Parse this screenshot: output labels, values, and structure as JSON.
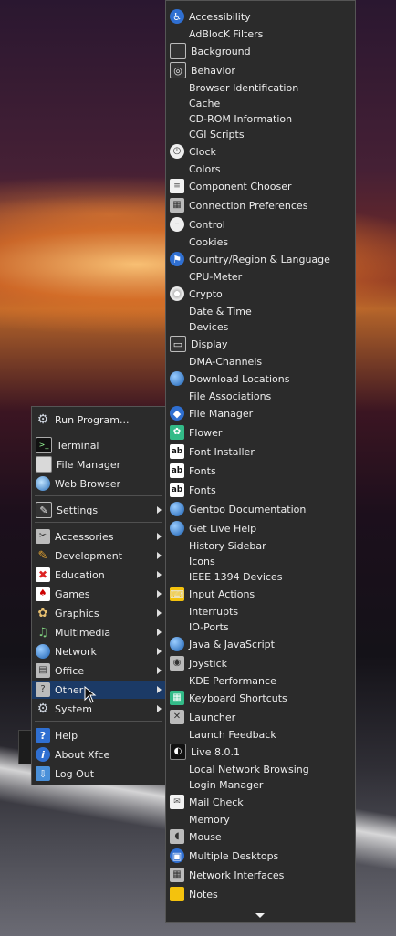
{
  "main_menu": {
    "items": [
      {
        "label": "Run Program...",
        "icon": "gear-icon",
        "submenu": false
      },
      {
        "label": "Terminal",
        "icon": "terminal-icon",
        "submenu": false
      },
      {
        "label": "File Manager",
        "icon": "file-manager-icon",
        "submenu": false
      },
      {
        "label": "Web Browser",
        "icon": "web-browser-icon",
        "submenu": false
      },
      {
        "label": "Settings",
        "icon": "settings-icon",
        "submenu": true
      },
      {
        "label": "Accessories",
        "icon": "accessories-icon",
        "submenu": true
      },
      {
        "label": "Development",
        "icon": "development-icon",
        "submenu": true
      },
      {
        "label": "Education",
        "icon": "education-icon",
        "submenu": true
      },
      {
        "label": "Games",
        "icon": "games-icon",
        "submenu": true
      },
      {
        "label": "Graphics",
        "icon": "graphics-icon",
        "submenu": true
      },
      {
        "label": "Multimedia",
        "icon": "multimedia-icon",
        "submenu": true
      },
      {
        "label": "Network",
        "icon": "network-icon",
        "submenu": true
      },
      {
        "label": "Office",
        "icon": "office-icon",
        "submenu": true
      },
      {
        "label": "Other",
        "icon": "other-icon",
        "submenu": true,
        "active": true
      },
      {
        "label": "System",
        "icon": "system-icon",
        "submenu": true
      },
      {
        "label": "Help",
        "icon": "help-icon",
        "submenu": false
      },
      {
        "label": "About Xfce",
        "icon": "info-icon",
        "submenu": false
      },
      {
        "label": "Log Out",
        "icon": "log-out-icon",
        "submenu": false
      }
    ]
  },
  "other_submenu": {
    "items": [
      {
        "label": "Accessibility",
        "icon": "accessibility-icon"
      },
      {
        "label": "AdBlocK Filters",
        "icon": ""
      },
      {
        "label": "Background",
        "icon": "background-icon"
      },
      {
        "label": "Behavior",
        "icon": "behavior-icon"
      },
      {
        "label": "Browser Identification",
        "icon": ""
      },
      {
        "label": "Cache",
        "icon": ""
      },
      {
        "label": "CD-ROM Information",
        "icon": ""
      },
      {
        "label": "CGI Scripts",
        "icon": ""
      },
      {
        "label": "Clock",
        "icon": "clock-icon"
      },
      {
        "label": "Colors",
        "icon": ""
      },
      {
        "label": "Component Chooser",
        "icon": "document-icon"
      },
      {
        "label": "Connection Preferences",
        "icon": "network-folder-icon"
      },
      {
        "label": "Control",
        "icon": "control-icon"
      },
      {
        "label": "Cookies",
        "icon": ""
      },
      {
        "label": "Country/Region & Language",
        "icon": "flag-icon"
      },
      {
        "label": "CPU-Meter",
        "icon": ""
      },
      {
        "label": "Crypto",
        "icon": "crypto-icon"
      },
      {
        "label": "Date & Time",
        "icon": ""
      },
      {
        "label": "Devices",
        "icon": ""
      },
      {
        "label": "Display",
        "icon": "display-icon"
      },
      {
        "label": "DMA-Channels",
        "icon": ""
      },
      {
        "label": "Download Locations",
        "icon": "globe-icon"
      },
      {
        "label": "File Associations",
        "icon": ""
      },
      {
        "label": "File Manager",
        "icon": "file-manager-cube-icon"
      },
      {
        "label": "Flower",
        "icon": "flower-icon"
      },
      {
        "label": "Font Installer",
        "icon": "font-icon"
      },
      {
        "label": "Fonts",
        "icon": "font-icon"
      },
      {
        "label": "Fonts",
        "icon": "font-icon"
      },
      {
        "label": "Gentoo Documentation",
        "icon": "globe-icon"
      },
      {
        "label": "Get Live Help",
        "icon": "globe-icon"
      },
      {
        "label": "History Sidebar",
        "icon": ""
      },
      {
        "label": "Icons",
        "icon": ""
      },
      {
        "label": "IEEE 1394 Devices",
        "icon": ""
      },
      {
        "label": "Input Actions",
        "icon": "keyboard-icon"
      },
      {
        "label": "Interrupts",
        "icon": ""
      },
      {
        "label": "IO-Ports",
        "icon": ""
      },
      {
        "label": "Java & JavaScript",
        "icon": "java-icon"
      },
      {
        "label": "Joystick",
        "icon": "joystick-icon"
      },
      {
        "label": "KDE Performance",
        "icon": ""
      },
      {
        "label": "Keyboard Shortcuts",
        "icon": "shortcuts-icon"
      },
      {
        "label": "Launcher",
        "icon": "launcher-icon"
      },
      {
        "label": "Launch Feedback",
        "icon": ""
      },
      {
        "label": "Live 8.0.1",
        "icon": "live-icon"
      },
      {
        "label": "Local Network Browsing",
        "icon": ""
      },
      {
        "label": "Login Manager",
        "icon": ""
      },
      {
        "label": "Mail Check",
        "icon": "mail-icon"
      },
      {
        "label": "Memory",
        "icon": ""
      },
      {
        "label": "Mouse",
        "icon": "mouse-icon"
      },
      {
        "label": "Multiple Desktops",
        "icon": "desktops-icon"
      },
      {
        "label": "Network Interfaces",
        "icon": "network-folder-icon"
      },
      {
        "label": "Notes",
        "icon": "notes-icon"
      }
    ]
  }
}
